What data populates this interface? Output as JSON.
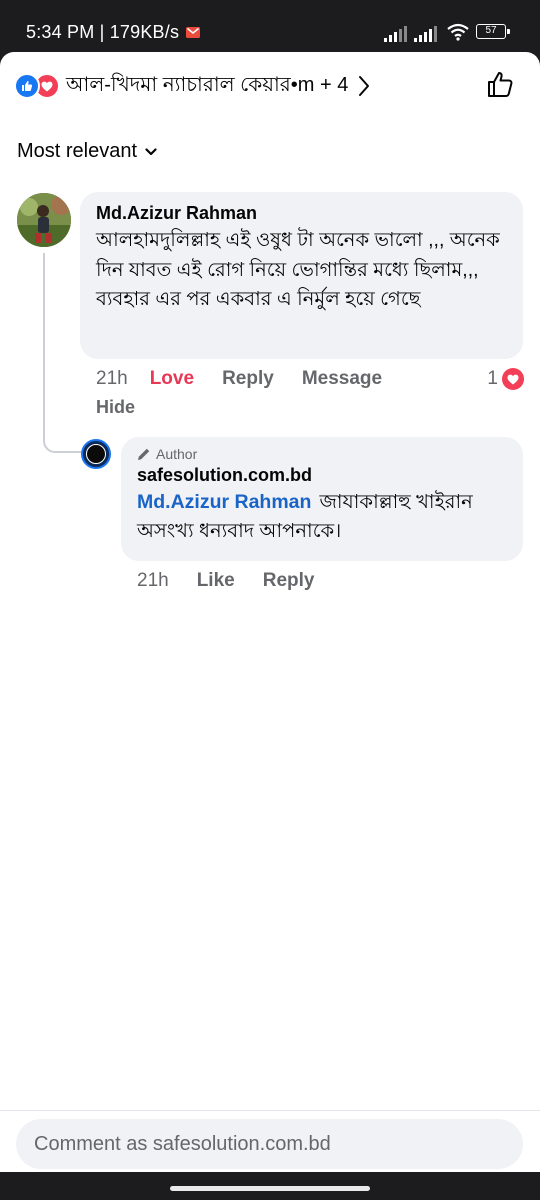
{
  "status_bar": {
    "time_speed": "5:34 PM | 179KB/s",
    "battery": "57"
  },
  "header": {
    "reactors_text": "আল-খিদমা ন্যাচারাল কেয়ার•m + 4"
  },
  "sort": {
    "label": "Most relevant"
  },
  "comment": {
    "author": "Md.Azizur Rahman",
    "text": "আলহামদুলিল্লাহ এই ওষুধ টা অনেক ভালো ,,, অনেক দিন যাবত এই রোগ নিয়ে ভোগান্তির মধ্যে ছিলাম,,, ব্যবহার এর পর একবার এ নির্মুল হয়ে গেছে",
    "time": "21h",
    "love_label": "Love",
    "reply_label": "Reply",
    "message_label": "Message",
    "reaction_count": "1",
    "hide_label": "Hide"
  },
  "reply": {
    "badge": "Author",
    "author": "safesolution.com.bd",
    "mention": "Md.Azizur Rahman",
    "text": "জাযাকাল্লাহু খাইরান অসংখ্য ধন্যবাদ আপনাকে।",
    "time": "21h",
    "like_label": "Like",
    "reply_label": "Reply"
  },
  "composer": {
    "placeholder": "Comment as safesolution.com.bd"
  },
  "colors": {
    "like_blue": "#1877f2",
    "love_red": "#f33e58",
    "mention_blue": "#1a64c8",
    "bubble_gray": "#f0f2f5"
  }
}
